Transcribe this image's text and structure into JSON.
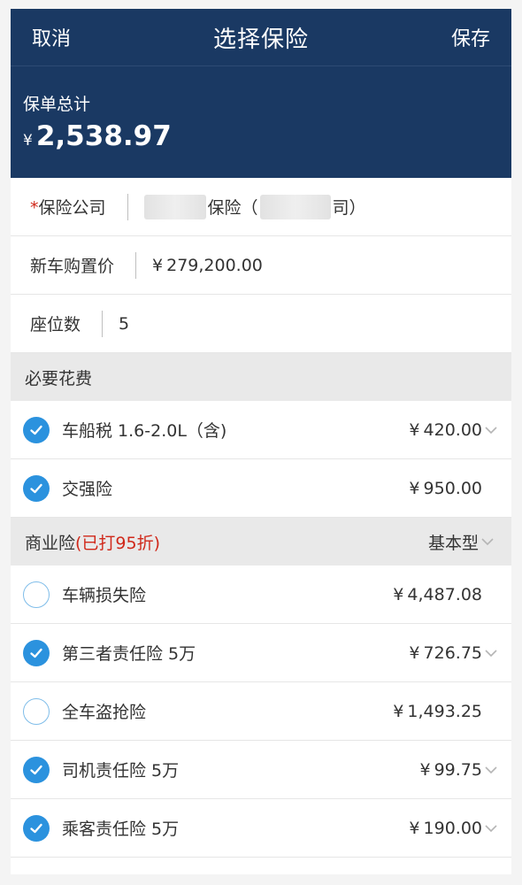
{
  "nav": {
    "cancel": "取消",
    "title": "选择保险",
    "save": "保存"
  },
  "summary": {
    "label": "保单总计",
    "currency": "¥",
    "amount": "2,538.97"
  },
  "form": {
    "company_label": "保险公司",
    "company_required_mark": "*",
    "company_part1": "保险（",
    "company_part2": "司）",
    "price_label": "新车购置价",
    "price_currency": "¥",
    "price_value": "279,200.00",
    "seats_label": "座位数",
    "seats_value": "5"
  },
  "required_section": {
    "title": "必要花费"
  },
  "required_items": [
    {
      "name": "车船税 1.6-2.0L（含)",
      "currency": "¥",
      "price": "420.00",
      "checked": true,
      "has_chevron": true
    },
    {
      "name": "交强险",
      "currency": "¥",
      "price": "950.00",
      "checked": true,
      "has_chevron": false
    }
  ],
  "commercial_section": {
    "title": "商业险",
    "discount": "(已打95折)",
    "plan": "基本型"
  },
  "commercial_items": [
    {
      "name": "车辆损失险",
      "currency": "¥",
      "price": "4,487.08",
      "checked": false,
      "has_chevron": false
    },
    {
      "name": "第三者责任险 5万",
      "currency": "¥",
      "price": "726.75",
      "checked": true,
      "has_chevron": true
    },
    {
      "name": "全车盗抢险",
      "currency": "¥",
      "price": "1,493.25",
      "checked": false,
      "has_chevron": false
    },
    {
      "name": "司机责任险 5万",
      "currency": "¥",
      "price": "99.75",
      "checked": true,
      "has_chevron": true
    },
    {
      "name": "乘客责任险 5万",
      "currency": "¥",
      "price": "190.00",
      "checked": true,
      "has_chevron": true
    }
  ],
  "colors": {
    "navy": "#1a3963",
    "check_blue": "#2b92de",
    "required_red": "#d0281a"
  },
  "icons": {
    "checked": "check-circle-icon",
    "unchecked": "empty-circle-icon",
    "chevron": "chevron-down-icon"
  }
}
